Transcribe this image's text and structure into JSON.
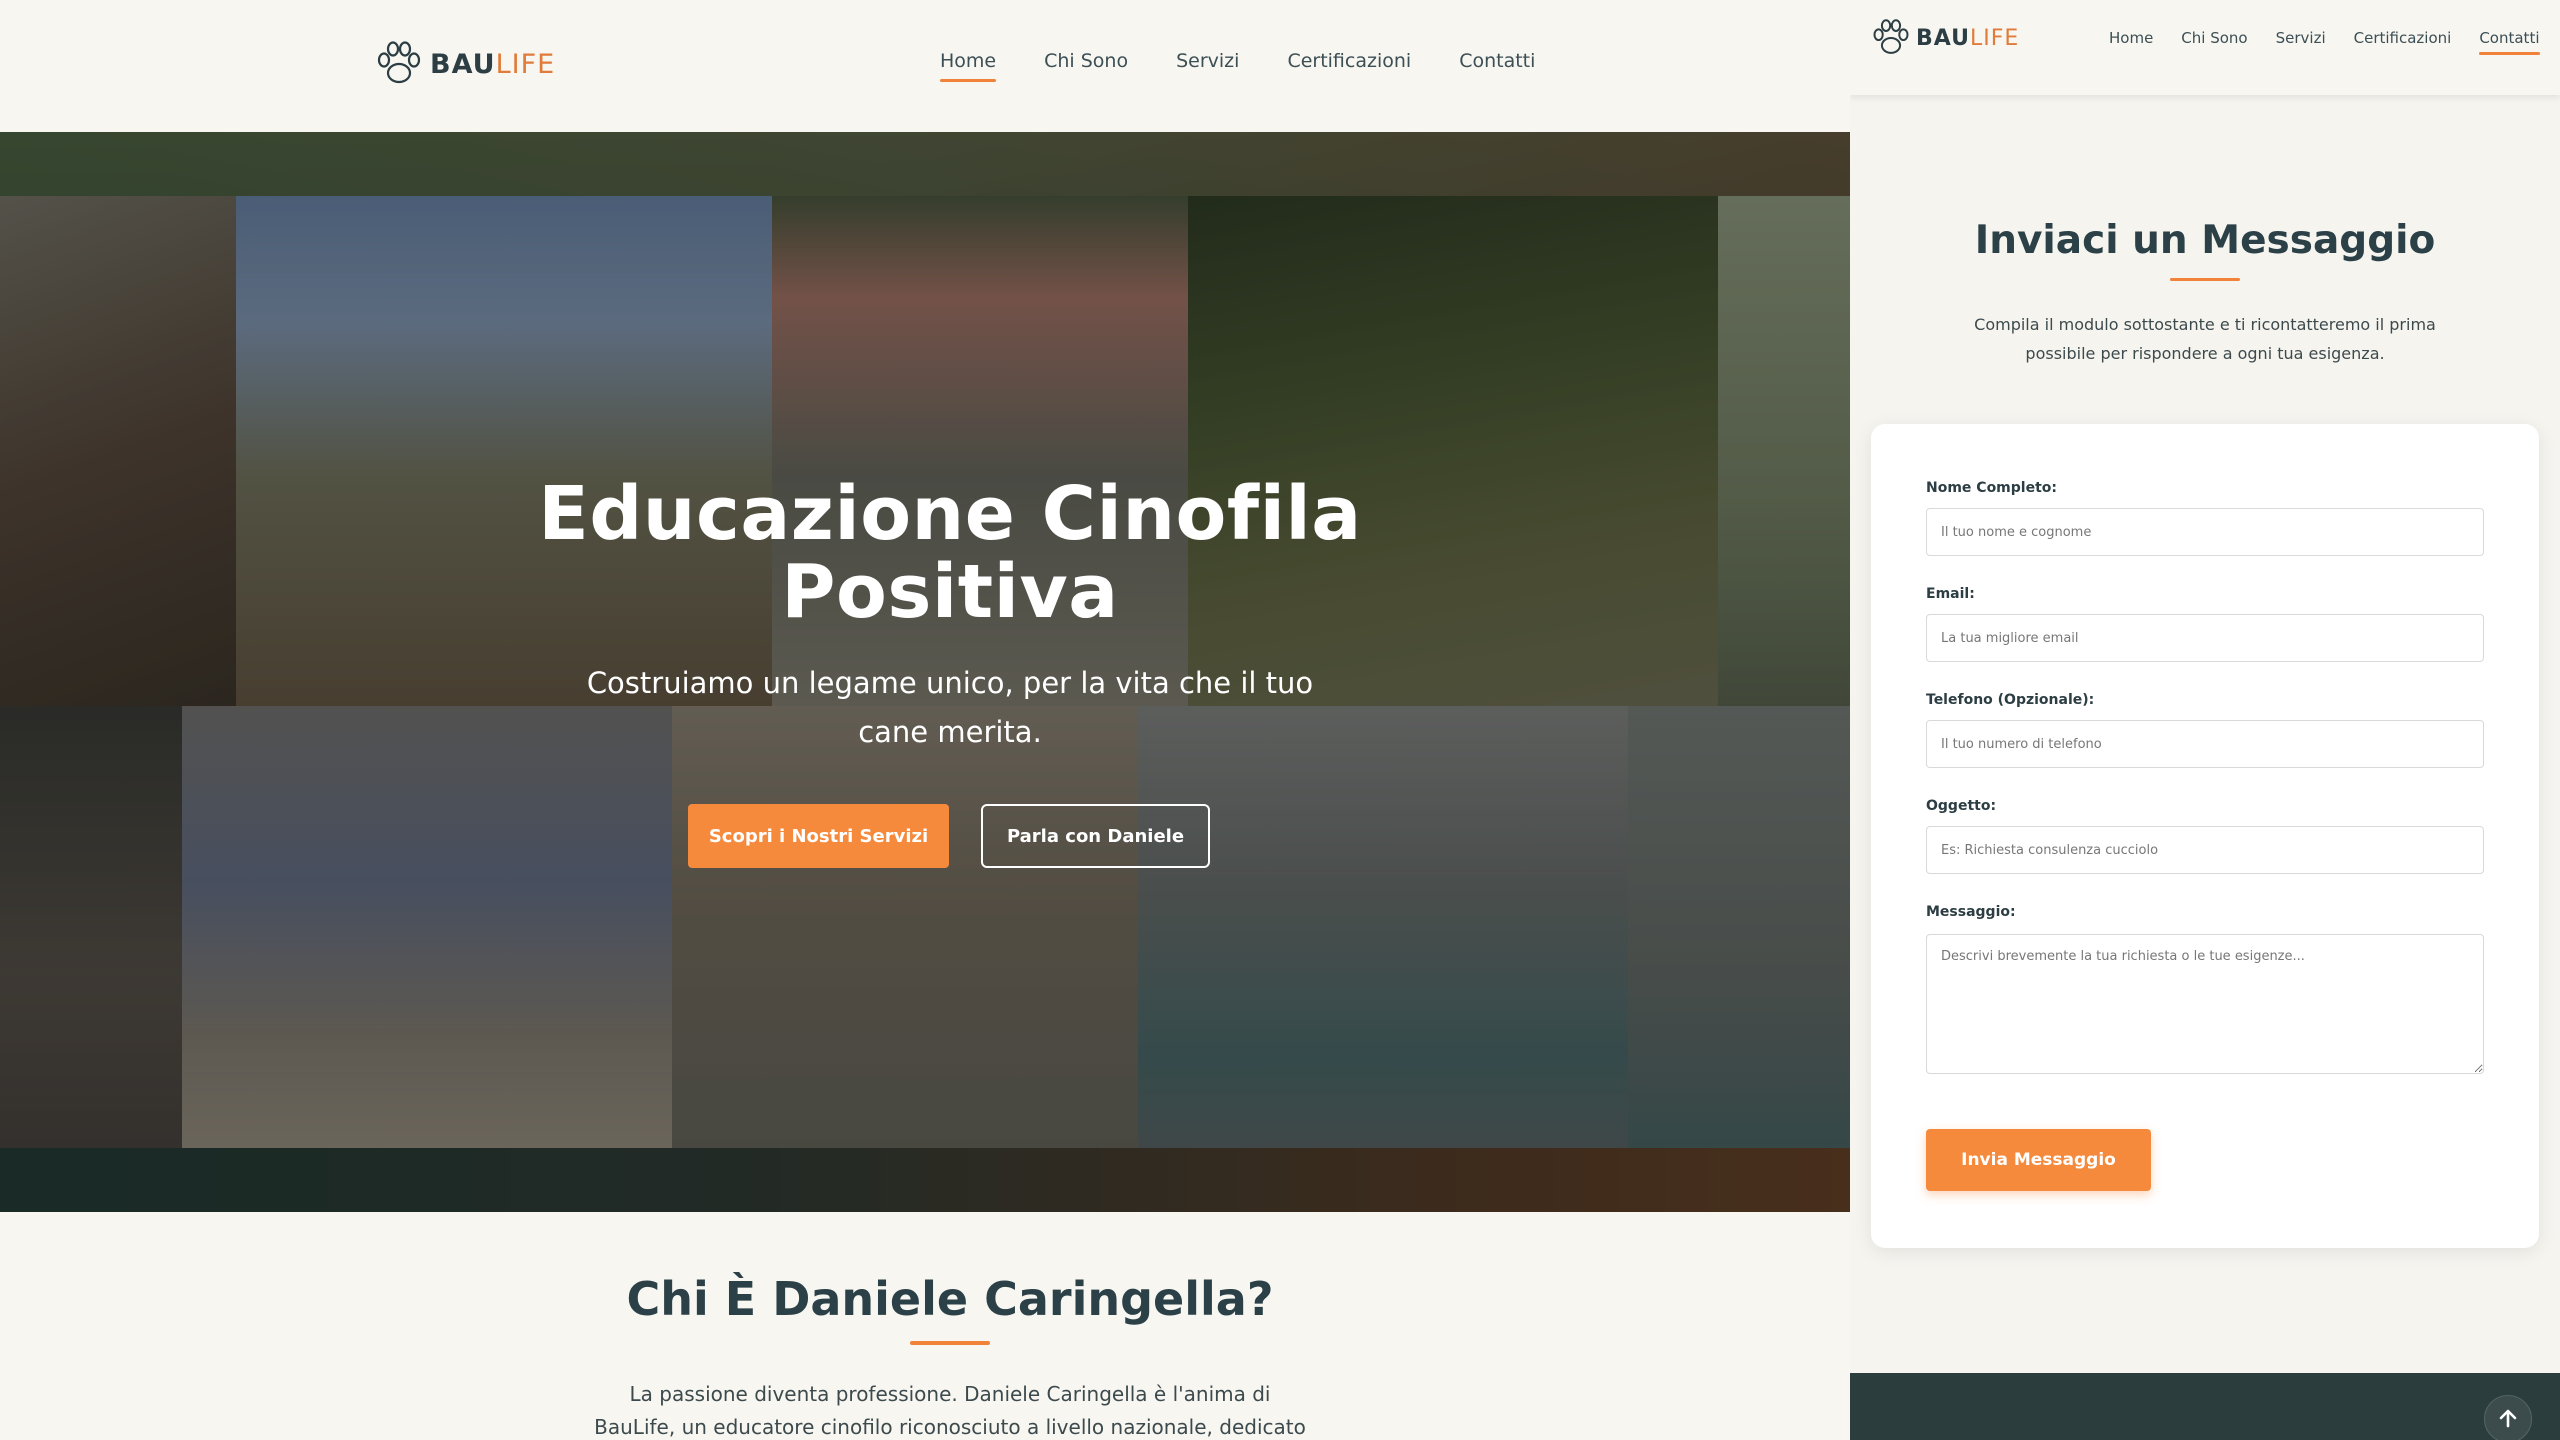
{
  "brand": {
    "name_part1": "BAU",
    "name_part2": "LIFE",
    "icon": "paw-print-icon",
    "accent_color": "#f08239",
    "dark_color": "#2b4047"
  },
  "left_page": {
    "nav": [
      {
        "label": "Home",
        "active": true
      },
      {
        "label": "Chi Sono",
        "active": false
      },
      {
        "label": "Servizi",
        "active": false
      },
      {
        "label": "Certificazioni",
        "active": false
      },
      {
        "label": "Contatti",
        "active": false
      }
    ],
    "hero": {
      "title": "Educazione Cinofila Positiva",
      "subtitle": "Costruiamo un legame unico, per la vita che il tuo cane merita.",
      "primary_button": "Scopri i Nostri Servizi",
      "secondary_button": "Parla con Daniele"
    },
    "about": {
      "title": "Chi È Daniele Caringella?",
      "text": "La passione diventa professione. Daniele Caringella è l'anima di BauLife, un educatore cinofilo riconosciuto a livello nazionale, dedicato al benessere del tuo"
    }
  },
  "right_page": {
    "nav": [
      {
        "label": "Home",
        "active": false
      },
      {
        "label": "Chi Sono",
        "active": false
      },
      {
        "label": "Servizi",
        "active": false
      },
      {
        "label": "Certificazioni",
        "active": false
      },
      {
        "label": "Contatti",
        "active": true
      }
    ],
    "contact": {
      "title": "Inviaci un Messaggio",
      "intro": "Compila il modulo sottostante e ti ricontatteremo il prima possibile per rispondere a ogni tua esigenza.",
      "fields": [
        {
          "label": "Nome Completo:",
          "placeholder": "Il tuo nome e cognome",
          "value": ""
        },
        {
          "label": "Email:",
          "placeholder": "La tua migliore email",
          "value": ""
        },
        {
          "label": "Telefono (Opzionale):",
          "placeholder": "Il tuo numero di telefono",
          "value": ""
        },
        {
          "label": "Oggetto:",
          "placeholder": "Es: Richiesta consulenza cucciolo",
          "value": ""
        },
        {
          "label": "Messaggio:",
          "placeholder": "Descrivi brevemente la tua richiesta o le tue esigenze...",
          "value": ""
        }
      ],
      "submit": "Invia Messaggio"
    },
    "scroll_top_icon": "arrow-up-icon"
  }
}
